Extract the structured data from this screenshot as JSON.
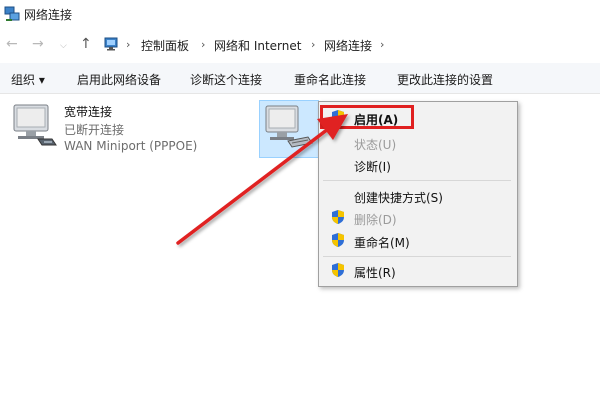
{
  "window": {
    "title": "网络连接"
  },
  "navigation": {
    "back_icon": "back-arrow-icon",
    "forward_icon": "forward-arrow-icon",
    "recent_icon": "chevron-down-icon",
    "up_icon": "up-arrow-icon",
    "breadcrumb": [
      "控制面板",
      "网络和 Internet",
      "网络连接"
    ]
  },
  "commands": {
    "organize": "组织 ▾",
    "enable_device": "启用此网络设备",
    "diagnose": "诊断这个连接",
    "rename": "重命名此连接",
    "change_settings": "更改此连接的设置"
  },
  "connections": [
    {
      "name": "宽带连接",
      "status": "已断开连接",
      "device": "WAN Miniport (PPPOE)"
    }
  ],
  "context_menu": {
    "items": [
      {
        "label": "启用(A)",
        "shield": true,
        "disabled": false,
        "highlighted": true
      },
      {
        "label": "状态(U)",
        "shield": false,
        "disabled": true
      },
      {
        "label": "诊断(I)",
        "shield": false,
        "disabled": false
      },
      {
        "label": "创建快捷方式(S)",
        "shield": false,
        "disabled": false
      },
      {
        "label": "删除(D)",
        "shield": true,
        "disabled": true
      },
      {
        "label": "重命名(M)",
        "shield": true,
        "disabled": false
      },
      {
        "label": "属性(R)",
        "shield": true,
        "disabled": false
      }
    ]
  },
  "colors": {
    "annotation_red": "#e02020",
    "selection_bg": "#cce8ff",
    "menu_bg": "#f2f2f2"
  }
}
